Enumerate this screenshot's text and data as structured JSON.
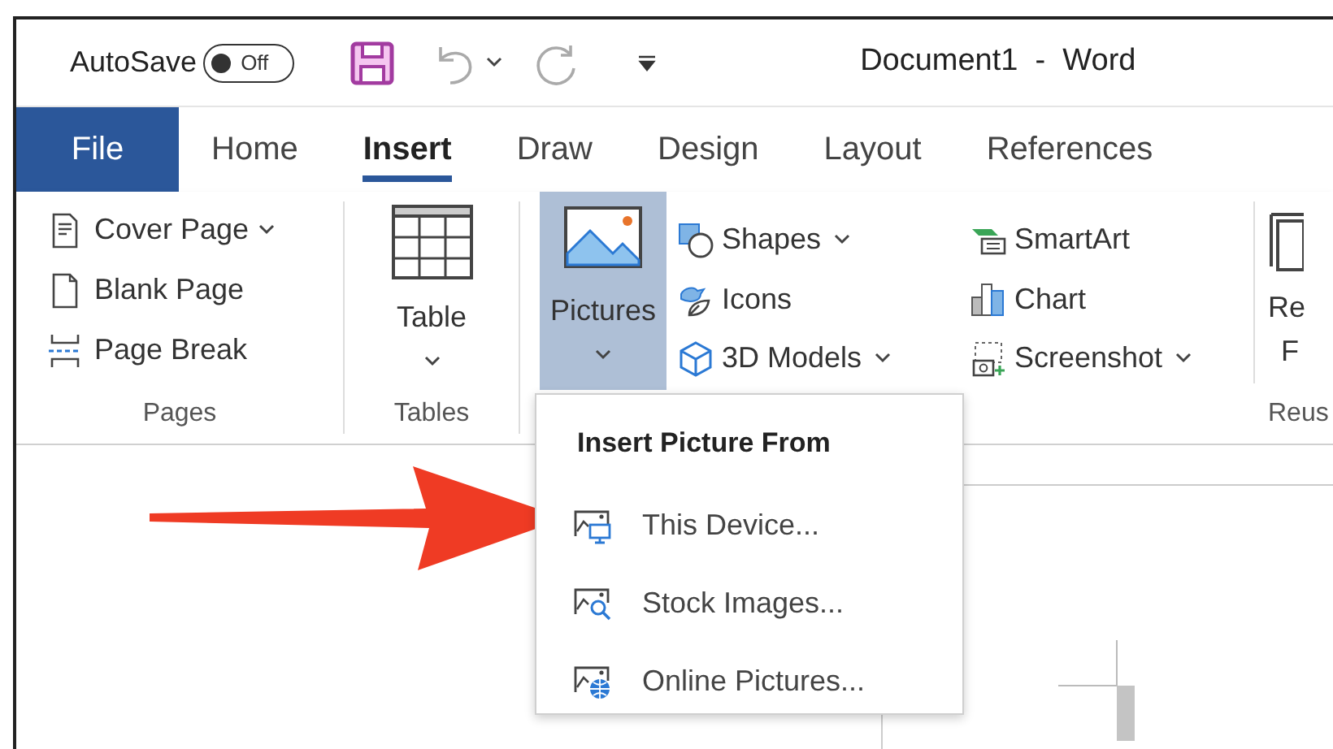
{
  "quick_access": {
    "autosave_label": "AutoSave",
    "autosave_on": false,
    "autosave_state": "Off"
  },
  "window_title": "Document1  -  Word",
  "tabs": [
    {
      "label": "File",
      "kind": "file",
      "selected": false
    },
    {
      "label": "Home",
      "kind": "tab",
      "selected": false
    },
    {
      "label": "Insert",
      "kind": "tab",
      "selected": true
    },
    {
      "label": "Draw",
      "kind": "tab",
      "selected": false
    },
    {
      "label": "Design",
      "kind": "tab",
      "selected": false
    },
    {
      "label": "Layout",
      "kind": "tab",
      "selected": false
    },
    {
      "label": "References",
      "kind": "tab",
      "selected": false
    }
  ],
  "ribbon": {
    "pages": {
      "label": "Pages",
      "items": [
        {
          "label": "Cover Page",
          "kind": "cover",
          "has_menu": true
        },
        {
          "label": "Blank Page",
          "kind": "blank",
          "has_menu": false
        },
        {
          "label": "Page Break",
          "kind": "break",
          "has_menu": false
        }
      ]
    },
    "tables": {
      "label": "Tables",
      "button": "Table"
    },
    "pictures": {
      "label": "Pictures",
      "expanded": true
    },
    "illustrations": [
      {
        "label": "Shapes",
        "kind": "shapes",
        "has_menu": true
      },
      {
        "label": "Icons",
        "kind": "icons",
        "has_menu": false
      },
      {
        "label": "3D Models",
        "kind": "models",
        "has_menu": true
      },
      {
        "label": "SmartArt",
        "kind": "smartart",
        "has_menu": false
      },
      {
        "label": "Chart",
        "kind": "chart",
        "has_menu": false
      },
      {
        "label": "Screenshot",
        "kind": "screenshot",
        "has_menu": true
      }
    ],
    "reuse": {
      "button_line_1": "Re",
      "button_line_2": "F",
      "label": "Reus"
    }
  },
  "menu": {
    "title": "Insert Picture From",
    "items": [
      {
        "label": "This Device...",
        "kind": "device"
      },
      {
        "label": "Stock Images...",
        "kind": "stock"
      },
      {
        "label": "Online Pictures...",
        "kind": "online"
      }
    ]
  }
}
